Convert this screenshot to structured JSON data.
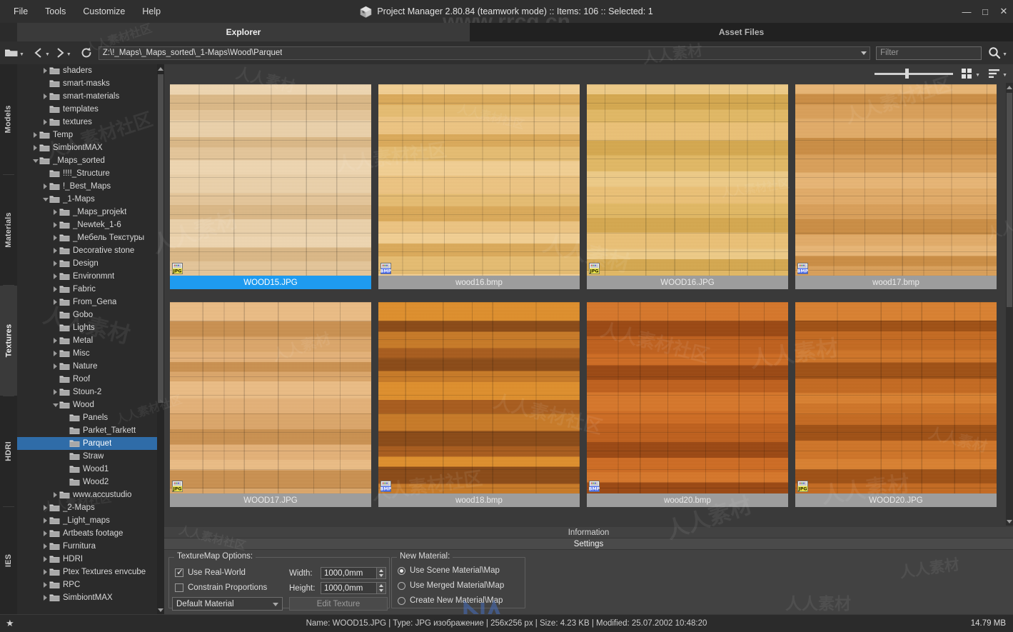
{
  "window": {
    "title": "Project Manager 2.80.84 (teamwork mode)  :: Items: 106  :: Selected: 1",
    "minimize_label": "—",
    "maximize_label": "□",
    "close_label": "✕",
    "logo_icon": "cube-icon"
  },
  "menubar": {
    "items": [
      {
        "label": "File"
      },
      {
        "label": "Tools"
      },
      {
        "label": "Customize"
      },
      {
        "label": "Help"
      }
    ]
  },
  "watermarks": {
    "rrcg": "www.rrcg.cn",
    "cn_text": "人人素材社区",
    "cn_short": "人人素材"
  },
  "main_tabs": [
    {
      "label": "Explorer",
      "active": true
    },
    {
      "label": "Asset Files",
      "active": false
    }
  ],
  "toolbar": {
    "folder_icon": "folder-icon",
    "back_icon": "back-arrow-icon",
    "forward_icon": "forward-arrow-icon",
    "refresh_icon": "refresh-icon",
    "path": "Z:\\!_Maps\\_Maps_sorted\\_1-Maps\\Wood\\Parquet",
    "filter_placeholder": "Filter",
    "filter_value": "",
    "search_icon": "search-icon",
    "dropdown_icon": "chevron-down-icon"
  },
  "view_tools": {
    "zoom_value": 40,
    "grid_view_icon": "grid-view-icon",
    "list_view_icon": "sort-list-icon"
  },
  "side_tabs": [
    {
      "label": "Models",
      "active": false
    },
    {
      "label": "Materials",
      "active": false
    },
    {
      "label": "Textures",
      "active": true
    },
    {
      "label": "HDRI",
      "active": false
    },
    {
      "label": "IES",
      "active": false
    }
  ],
  "tree": [
    {
      "label": "shaders",
      "depth": 2,
      "arrow": "closed",
      "selected": false
    },
    {
      "label": "smart-masks",
      "depth": 2,
      "arrow": "none",
      "selected": false
    },
    {
      "label": "smart-materials",
      "depth": 2,
      "arrow": "closed",
      "selected": false
    },
    {
      "label": "templates",
      "depth": 2,
      "arrow": "none",
      "selected": false
    },
    {
      "label": "textures",
      "depth": 2,
      "arrow": "closed",
      "selected": false
    },
    {
      "label": "Temp",
      "depth": 1,
      "arrow": "closed",
      "selected": false
    },
    {
      "label": "SimbiontMAX",
      "depth": 1,
      "arrow": "closed",
      "selected": false
    },
    {
      "label": "_Maps_sorted",
      "depth": 1,
      "arrow": "open",
      "selected": false
    },
    {
      "label": "!!!!_Structure",
      "depth": 2,
      "arrow": "none",
      "selected": false
    },
    {
      "label": "!_Best_Maps",
      "depth": 2,
      "arrow": "closed",
      "selected": false
    },
    {
      "label": "_1-Maps",
      "depth": 2,
      "arrow": "open",
      "selected": false
    },
    {
      "label": "_Maps_projekt",
      "depth": 3,
      "arrow": "closed",
      "selected": false
    },
    {
      "label": "_Newtek_1-6",
      "depth": 3,
      "arrow": "closed",
      "selected": false
    },
    {
      "label": "_Мебель Текстуры",
      "depth": 3,
      "arrow": "closed",
      "selected": false
    },
    {
      "label": "Decorative stone",
      "depth": 3,
      "arrow": "closed",
      "selected": false
    },
    {
      "label": "Design",
      "depth": 3,
      "arrow": "closed",
      "selected": false
    },
    {
      "label": "Environmnt",
      "depth": 3,
      "arrow": "closed",
      "selected": false
    },
    {
      "label": "Fabric",
      "depth": 3,
      "arrow": "closed",
      "selected": false
    },
    {
      "label": "From_Gena",
      "depth": 3,
      "arrow": "closed",
      "selected": false
    },
    {
      "label": "Gobo",
      "depth": 3,
      "arrow": "none",
      "selected": false
    },
    {
      "label": "Lights",
      "depth": 3,
      "arrow": "none",
      "selected": false
    },
    {
      "label": "Metal",
      "depth": 3,
      "arrow": "closed",
      "selected": false
    },
    {
      "label": "Misc",
      "depth": 3,
      "arrow": "closed",
      "selected": false
    },
    {
      "label": "Nature",
      "depth": 3,
      "arrow": "closed",
      "selected": false
    },
    {
      "label": "Roof",
      "depth": 3,
      "arrow": "none",
      "selected": false
    },
    {
      "label": "Stoun-2",
      "depth": 3,
      "arrow": "closed",
      "selected": false
    },
    {
      "label": "Wood",
      "depth": 3,
      "arrow": "open",
      "selected": false
    },
    {
      "label": "Panels",
      "depth": 4,
      "arrow": "none",
      "selected": false
    },
    {
      "label": "Parket_Tarkett",
      "depth": 4,
      "arrow": "none",
      "selected": false
    },
    {
      "label": "Parquet",
      "depth": 4,
      "arrow": "none",
      "selected": true
    },
    {
      "label": "Straw",
      "depth": 4,
      "arrow": "none",
      "selected": false
    },
    {
      "label": "Wood1",
      "depth": 4,
      "arrow": "none",
      "selected": false
    },
    {
      "label": "Wood2",
      "depth": 4,
      "arrow": "none",
      "selected": false
    },
    {
      "label": "www.accustudio",
      "depth": 3,
      "arrow": "closed",
      "selected": false
    },
    {
      "label": "_2-Maps",
      "depth": 2,
      "arrow": "closed",
      "selected": false
    },
    {
      "label": "_Light_maps",
      "depth": 2,
      "arrow": "closed",
      "selected": false
    },
    {
      "label": "Artbeats footage",
      "depth": 2,
      "arrow": "closed",
      "selected": false
    },
    {
      "label": "Furnitura",
      "depth": 2,
      "arrow": "closed",
      "selected": false
    },
    {
      "label": "HDRI",
      "depth": 2,
      "arrow": "closed",
      "selected": false
    },
    {
      "label": "Ptex Textures envcube",
      "depth": 2,
      "arrow": "closed",
      "selected": false
    },
    {
      "label": "RPC",
      "depth": 2,
      "arrow": "closed",
      "selected": false
    },
    {
      "label": "SimbiontMAX",
      "depth": 2,
      "arrow": "closed",
      "selected": false
    }
  ],
  "thumbnails": [
    {
      "label": "WOOD15.JPG",
      "format": "JPG",
      "selected": true,
      "base": "#e6c79a",
      "band1": "#f0d7b2",
      "band2": "#dcb987",
      "band3": "#ecd2ab"
    },
    {
      "label": "wood16.bmp",
      "format": "BMP",
      "selected": false,
      "base": "#e7bd71",
      "band1": "#f3d093",
      "band2": "#dcab5a",
      "band3": "#eec582"
    },
    {
      "label": "WOOD16.JPG",
      "format": "JPG",
      "selected": false,
      "base": "#e3b964",
      "band1": "#efcc87",
      "band2": "#d6a94f",
      "band3": "#ecc276"
    },
    {
      "label": "wood17.bmp",
      "format": "BMP",
      "selected": false,
      "base": "#dba059",
      "band1": "#e9b675",
      "band2": "#cc8e44",
      "band3": "#e3ac68"
    },
    {
      "label": "WOOD17.JPG",
      "format": "JPG",
      "selected": false,
      "base": "#dda76a",
      "band1": "#ecbd85",
      "band2": "#cb9150",
      "band3": "#e5b278"
    },
    {
      "label": "wood18.bmp",
      "format": "BMP",
      "selected": false,
      "base": "#c97a26",
      "band1": "#e08f2c",
      "band2": "#8b4a16",
      "band3": "#a95c1c"
    },
    {
      "label": "wood20.bmp",
      "format": "BMP",
      "selected": false,
      "base": "#c0601c",
      "band1": "#d7772a",
      "band2": "#9c4812",
      "band3": "#cf6c22"
    },
    {
      "label": "WOOD20.JPG",
      "format": "JPG",
      "selected": false,
      "base": "#c56a20",
      "band1": "#da8130",
      "band2": "#a05014",
      "band3": "#d07527"
    }
  ],
  "info_tabs": [
    {
      "label": "Information",
      "active": false
    },
    {
      "label": "Settings",
      "active": true
    }
  ],
  "options": {
    "texturemap": {
      "legend": "TextureMap Options:",
      "use_real_world": {
        "label": "Use Real-World",
        "checked": true
      },
      "constrain_proportions": {
        "label": "Constrain Proportions",
        "checked": false
      },
      "width": {
        "label": "Width:",
        "value": "1000,0mm"
      },
      "height": {
        "label": "Height:",
        "value": "1000,0mm"
      },
      "material_combo": "Default Material",
      "edit_texture_button": "Edit Texture"
    },
    "new_material": {
      "legend": "New Material:",
      "options": [
        {
          "label": "Use Scene Material\\Map",
          "selected": true
        },
        {
          "label": "Use Merged Material\\Map",
          "selected": false
        },
        {
          "label": "Create New Material\\Map",
          "selected": false
        }
      ]
    }
  },
  "statusbar": {
    "star_icon": "star-icon",
    "info": "Name: WOOD15.JPG | Type: JPG изображение | 256x256 px | Size: 4.23 KB | Modified: 25.07.2002 10:48:20",
    "memory": "14.79 MB"
  }
}
